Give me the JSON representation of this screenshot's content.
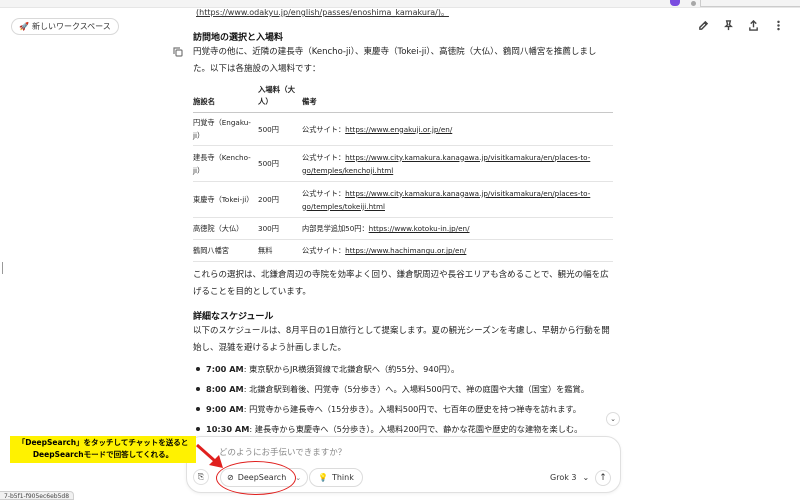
{
  "header": {
    "workspace_label": "新しいワークスペース"
  },
  "content": {
    "url_top": "(https://www.odakyu.jp/english/passes/enoshima_kamakura/)。",
    "heading_visits": "訪問地の選択と入場料",
    "intro": "円覚寺の他に、近隣の建長寺（Kencho-ji）、東慶寺（Tokei-ji）、高徳院（大仏）、鶴岡八幡宮を推薦しました。以下は各施設の入場料です：",
    "table": {
      "headers": [
        "施設名",
        "入場料（大人）",
        "備考"
      ],
      "rows": [
        {
          "name": "円覚寺（Engaku-ji）",
          "fee": "500円",
          "note_prefix": "公式サイト：",
          "note_link": "https://www.engakuji.or.jp/en/"
        },
        {
          "name": "建長寺（Kencho-ji）",
          "fee": "500円",
          "note_prefix": "公式サイト：",
          "note_link": "https://www.city.kamakura.kanagawa.jp/visitkamakura/en/places-to-go/temples/kenchoji.html"
        },
        {
          "name": "東慶寺（Tokei-ji）",
          "fee": "200円",
          "note_prefix": "公式サイト：",
          "note_link": "https://www.city.kamakura.kanagawa.jp/visitkamakura/en/places-to-go/temples/tokeiji.html"
        },
        {
          "name": "高徳院（大仏）",
          "fee": "300円",
          "note_prefix": "内部見学追加50円：",
          "note_link": "https://www.kotoku-in.jp/en/"
        },
        {
          "name": "鶴岡八幡宮",
          "fee": "無料",
          "note_prefix": "公式サイト：",
          "note_link": "https://www.hachimangu.or.jp/en/"
        }
      ]
    },
    "para_after_table": "これらの選択は、北鎌倉周辺の寺院を効率よく回り、鎌倉駅周辺や長谷エリアも含めることで、観光の幅を広げることを目的としています。",
    "heading_schedule": "詳細なスケジュール",
    "schedule_intro": "以下のスケジュールは、8月平日の1日旅行として提案します。夏の観光シーズンを考慮し、早朝から行動を開始し、混雑を避けるよう計画しました。",
    "schedule": [
      {
        "time": "7:00 AM",
        "text": ": 東京駅からJR横須賀線で北鎌倉駅へ（約55分、940円）。"
      },
      {
        "time": "8:00 AM",
        "text": ": 北鎌倉駅到着後、円覚寺（5分歩き）へ。入場料500円で、禅の庭園や大鐘（国宝）を鑑賞。"
      },
      {
        "time": "9:00 AM",
        "text": ": 円覚寺から建長寺へ（15分歩き）。入場料500円で、七百年の歴史を持つ禅寺を訪れます。"
      },
      {
        "time": "10:30 AM",
        "text": ": 建長寺から東慶寺へ（5分歩き）。入場料200円で、静かな花園や歴史的な建物を楽しむ。"
      }
    ]
  },
  "composer": {
    "placeholder": "どのようにお手伝いできますか？",
    "deepsearch_label": "DeepSearch",
    "think_label": "Think",
    "model_label": "Grok 3"
  },
  "annotation": {
    "line1": "「DeepSearch」をタッチしてチャットを送ると",
    "line2": "DeepSearchモードで回答してくれる。"
  },
  "status_bar": "7-b5f1-f905ec6eb5d8"
}
